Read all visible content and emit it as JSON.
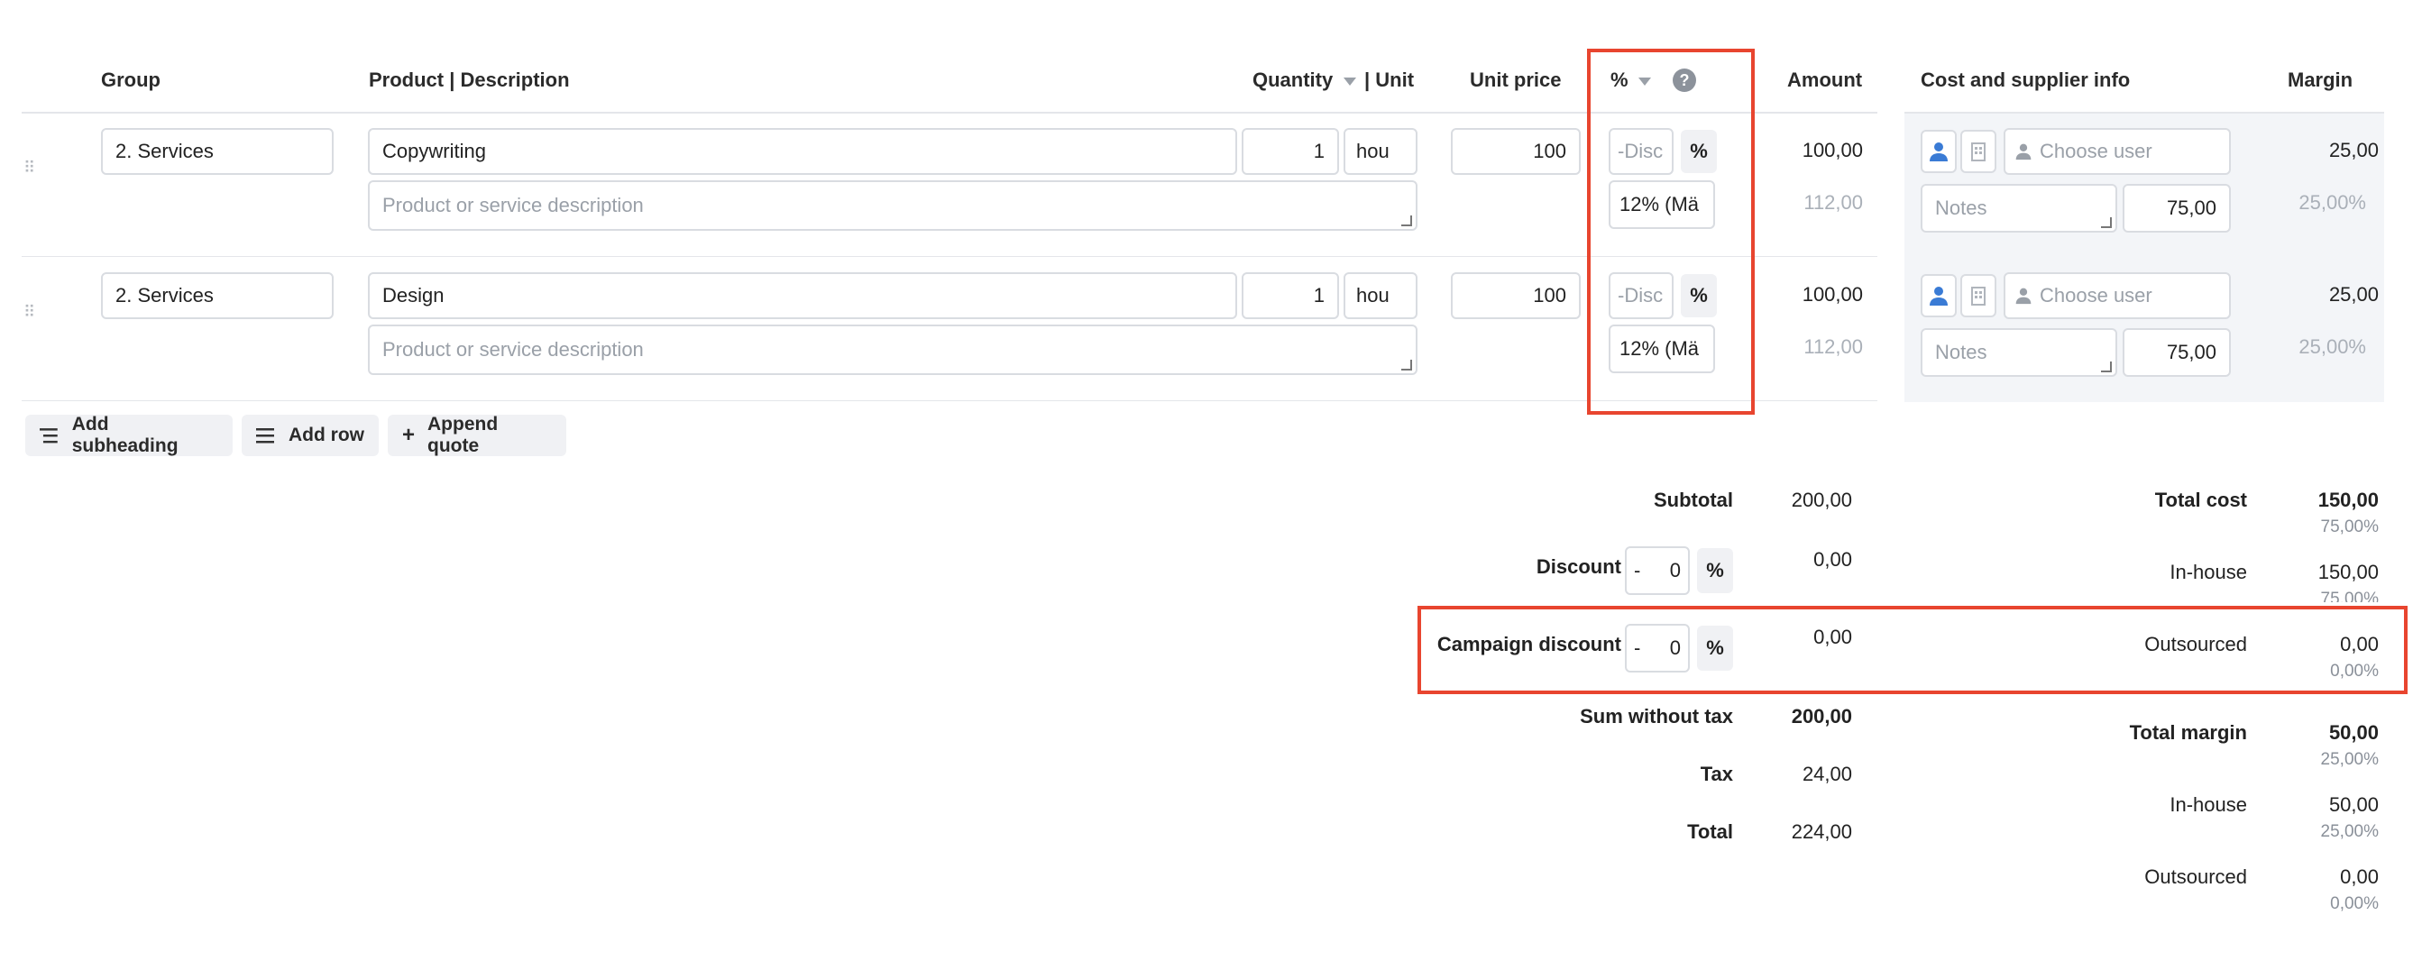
{
  "columns": {
    "group": "Group",
    "product": "Product | Description",
    "quantity": "Quantity",
    "unit": "| Unit",
    "unit_price": "Unit price",
    "percent": "%",
    "amount": "Amount",
    "cost_supplier": "Cost and supplier info",
    "margin": "Margin"
  },
  "rows": [
    {
      "group": "2. Services",
      "product": "Copywriting",
      "description_placeholder": "Product or service description",
      "quantity": "1",
      "unit": "hou",
      "unit_price": "100",
      "discount_placeholder": "-Disc",
      "pct_button": "%",
      "tax": "12% (Mä",
      "amount": "100,00",
      "amount_with_tax": "112,00",
      "choose_user_placeholder": "Choose user",
      "notes_placeholder": "Notes",
      "cost": "75,00",
      "margin": "25,00",
      "margin_pct": "25,00%"
    },
    {
      "group": "2. Services",
      "product": "Design",
      "description_placeholder": "Product or service description",
      "quantity": "1",
      "unit": "hou",
      "unit_price": "100",
      "discount_placeholder": "-Disc",
      "pct_button": "%",
      "tax": "12% (Mä",
      "amount": "100,00",
      "amount_with_tax": "112,00",
      "choose_user_placeholder": "Choose user",
      "notes_placeholder": "Notes",
      "cost": "75,00",
      "margin": "25,00",
      "margin_pct": "25,00%"
    }
  ],
  "actions": {
    "add_subheading": "Add subheading",
    "add_row": "Add row",
    "append_quote": "Append quote"
  },
  "totals": {
    "subtotal_label": "Subtotal",
    "subtotal": "200,00",
    "discount_label": "Discount",
    "discount_sign": "-",
    "discount_value": "0",
    "discount_pct": "%",
    "discount_amount": "0,00",
    "campaign_label": "Campaign discount",
    "campaign_sign": "-",
    "campaign_value": "0",
    "campaign_pct": "%",
    "campaign_amount": "0,00",
    "sum_without_tax_label": "Sum without tax",
    "sum_without_tax": "200,00",
    "tax_label": "Tax",
    "tax": "24,00",
    "total_label": "Total",
    "total": "224,00"
  },
  "cost_summary": {
    "total_cost_label": "Total cost",
    "total_cost": "150,00",
    "total_cost_pct": "75,00%",
    "inhouse_label": "In-house",
    "inhouse_cost": "150,00",
    "inhouse_cost_pct": "75,00%",
    "outsourced_label": "Outsourced",
    "outsourced_cost": "0,00",
    "outsourced_cost_pct": "0,00%",
    "total_margin_label": "Total margin",
    "total_margin": "50,00",
    "total_margin_pct": "25,00%",
    "inhouse_margin_label": "In-house",
    "inhouse_margin": "50,00",
    "inhouse_margin_pct": "25,00%",
    "outsourced_margin_label": "Outsourced",
    "outsourced_margin": "0,00",
    "outsourced_margin_pct": "0,00%"
  },
  "colors": {
    "highlight": "#e8452f",
    "user_icon_active": "#3a7bd5",
    "cost_panel_bg": "#f3f5f8"
  }
}
